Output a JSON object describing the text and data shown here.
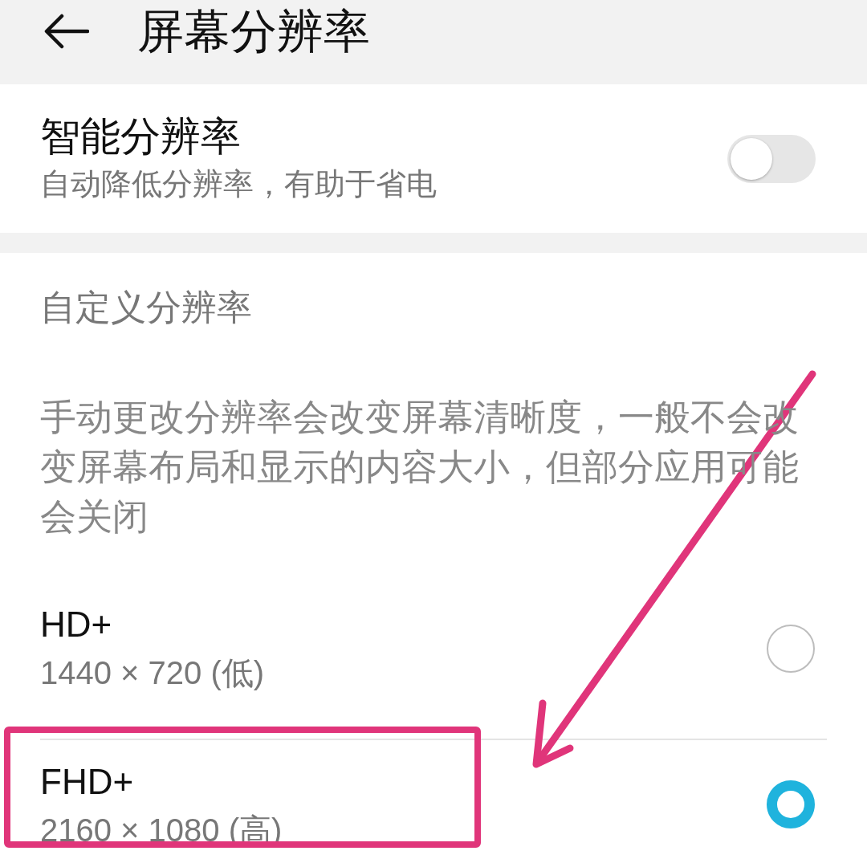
{
  "header": {
    "title": "屏幕分辨率"
  },
  "smart_resolution": {
    "title": "智能分辨率",
    "subtitle": "自动降低分辨率，有助于省电",
    "on": false
  },
  "custom_resolution": {
    "heading": "自定义分辨率",
    "description": "手动更改分辨率会改变屏幕清晰度，一般不会改变屏幕布局和显示的内容大小，但部分应用可能会关闭"
  },
  "options": [
    {
      "label": "HD+",
      "detail": "1440 × 720 (低)",
      "selected": false
    },
    {
      "label": "FHD+",
      "detail": "2160 × 1080 (高)",
      "selected": true
    }
  ]
}
